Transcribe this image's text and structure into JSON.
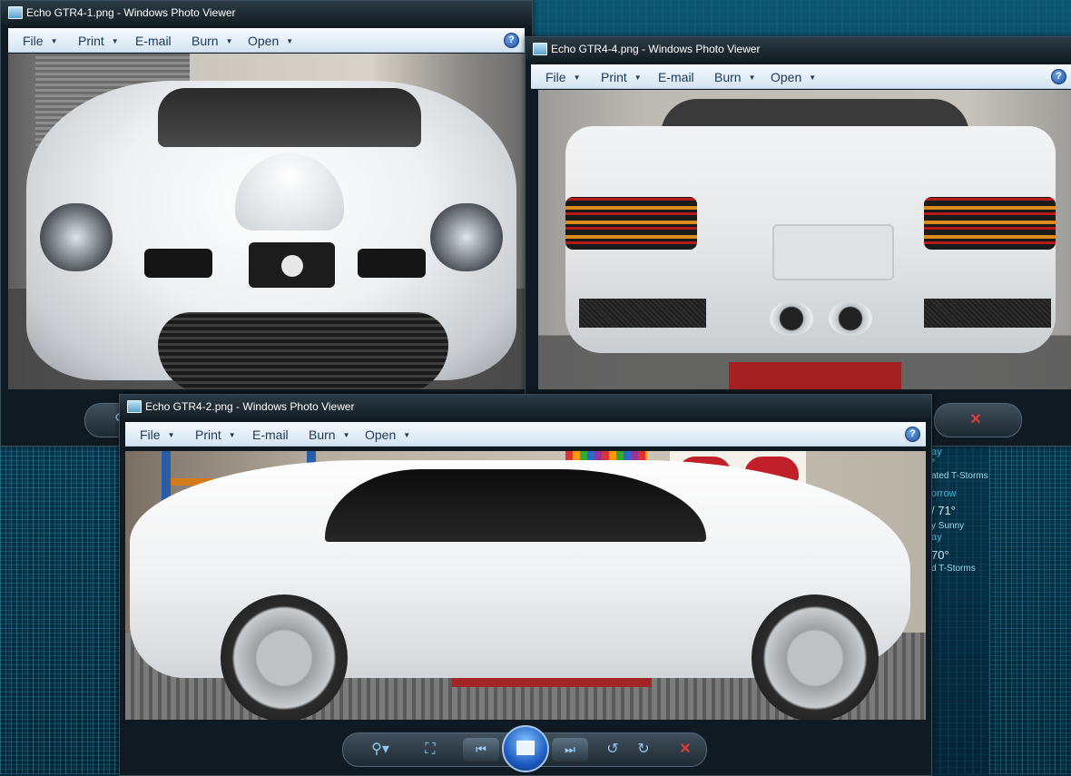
{
  "windows": [
    {
      "id": "gtr4-1",
      "title": "Echo GTR4-1.png - Windows Photo Viewer",
      "image_subject": "Echo GTR4 front view",
      "menu": [
        "File",
        "Print",
        "E-mail",
        "Burn",
        "Open"
      ],
      "help": "?"
    },
    {
      "id": "gtr4-4",
      "title": "Echo GTR4-4.png - Windows Photo Viewer",
      "image_subject": "Echo GTR4 rear view",
      "menu": [
        "File",
        "Print",
        "E-mail",
        "Burn",
        "Open"
      ],
      "help": "?"
    },
    {
      "id": "gtr4-2",
      "title": "Echo GTR4-2.png - Windows Photo Viewer",
      "image_subject": "Echo GTR4 side view",
      "menu": [
        "File",
        "Print",
        "E-mail",
        "Burn",
        "Open"
      ],
      "help": "?"
    }
  ],
  "toolbar": {
    "zoom": "zoom-icon",
    "actual_size": "fit-window-icon",
    "previous": "previous-icon",
    "slideshow": "slideshow-icon",
    "next": "next-icon",
    "rotate_ccw": "rotate-counterclockwise-icon",
    "rotate_cw": "rotate-clockwise-icon",
    "delete": "delete-icon"
  },
  "weather_gadget": {
    "day1": "ay",
    "line1": "°",
    "line2": "ated T-Storms",
    "line3": "orrow",
    "line4": "/ 71°",
    "line5": "y Sunny",
    "line6": "ay",
    "line7": "70°",
    "line8": "d T-Storms"
  },
  "colors": {
    "menubar": "#e3eef7",
    "menu_text": "#1e395b",
    "titlebar": "#141e25",
    "close_icon": "#e03a3a"
  }
}
